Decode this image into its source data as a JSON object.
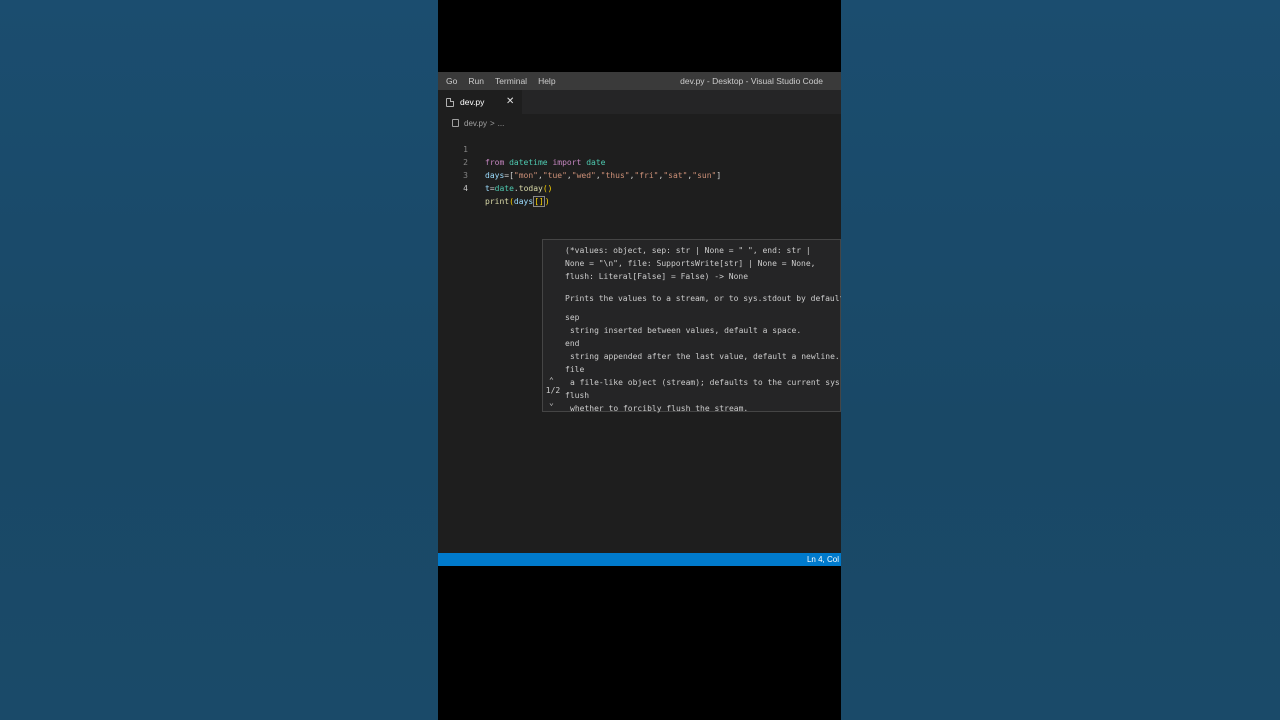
{
  "menu": [
    "Go",
    "Run",
    "Terminal",
    "Help"
  ],
  "window_title": "dev.py - Desktop - Visual Studio Code",
  "tab": {
    "label": "dev.py",
    "close": "✕"
  },
  "breadcrumb": {
    "file": "dev.py",
    "sep": ">",
    "rest": "..."
  },
  "lines": [
    {
      "num": "1"
    },
    {
      "num": "2"
    },
    {
      "num": "3"
    },
    {
      "num": "4"
    }
  ],
  "code": {
    "l1": {
      "kw1": "from",
      "mod": "datetime",
      "kw2": "import",
      "name": "date"
    },
    "l2": {
      "var": "days",
      "eq": "=[",
      "s1": "\"mon\"",
      "s2": "\"tue\"",
      "s3": "\"wed\"",
      "s4": "\"thus\"",
      "s5": "\"fri\"",
      "s6": "\"sat\"",
      "s7": "\"sun\"",
      "close": "]",
      "comma": ","
    },
    "l3": {
      "var": "t",
      "eq": "=",
      "obj": "date",
      "dot": ".",
      "fn": "today",
      "paren": "()"
    },
    "l4": {
      "fn": "print",
      "open": "(",
      "var": "days",
      "sq": "[]",
      "close": ")"
    }
  },
  "hover": {
    "sig": [
      "(*values: object, sep: str | None = \" \", end: str |",
      "None = \"\\n\", file: SupportsWrite[str] | None = None,",
      "flush: Literal[False] = False) -> None"
    ],
    "summary": "Prints the values to a stream, or to sys.stdout by default.",
    "params": [
      {
        "name": "sep",
        "desc": "string inserted between values, default a space."
      },
      {
        "name": "end",
        "desc": "string appended after the last value, default a newline."
      },
      {
        "name": "file",
        "desc": "a file-like object (stream); defaults to the current sys.stdout."
      },
      {
        "name": "flush",
        "desc": "whether to forcibly flush the stream."
      }
    ],
    "counter": "1/2"
  },
  "status": {
    "position": "Ln 4, Col"
  },
  "colors": {
    "statusbar": "#007acc",
    "editor_bg": "#1e1e1e",
    "page_bg": "#1a4a6b"
  }
}
